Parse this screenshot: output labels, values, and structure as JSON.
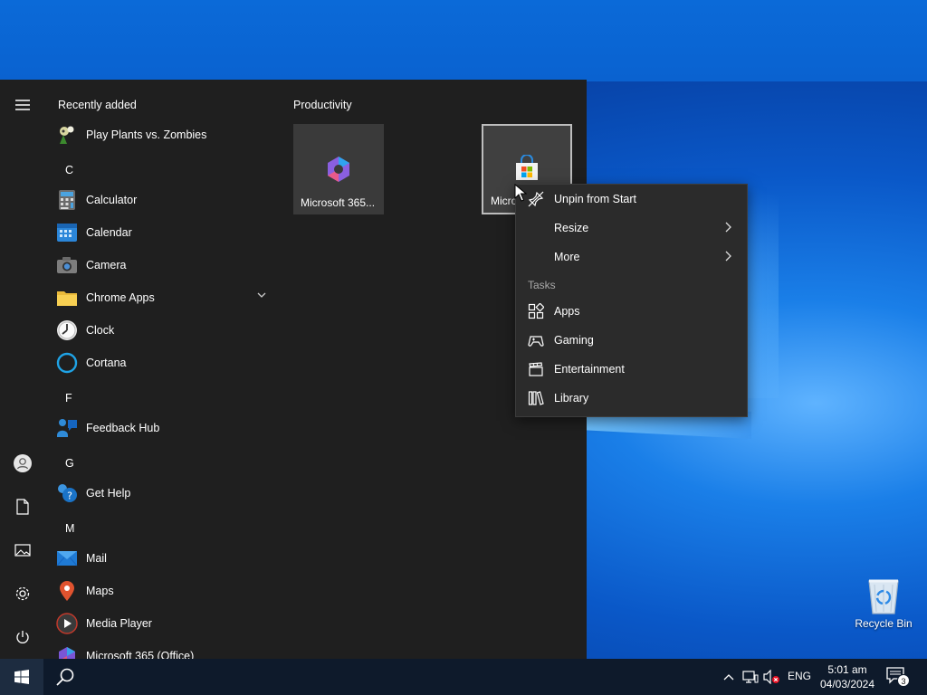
{
  "desktop": {
    "recycle_bin_label": "Recycle Bin"
  },
  "start_menu": {
    "recently_added_header": "Recently added",
    "apps": [
      {
        "name": "Play Plants vs. Zombies",
        "icon": "plants-vs-zombies-icon"
      },
      {
        "letter": "C"
      },
      {
        "name": "Calculator",
        "icon": "calculator-icon"
      },
      {
        "name": "Calendar",
        "icon": "calendar-icon"
      },
      {
        "name": "Camera",
        "icon": "camera-icon"
      },
      {
        "name": "Chrome Apps",
        "icon": "folder-icon",
        "expandable": true
      },
      {
        "name": "Clock",
        "icon": "clock-icon"
      },
      {
        "name": "Cortana",
        "icon": "cortana-icon"
      },
      {
        "letter": "F"
      },
      {
        "name": "Feedback Hub",
        "icon": "feedback-hub-icon"
      },
      {
        "letter": "G"
      },
      {
        "name": "Get Help",
        "icon": "get-help-icon"
      },
      {
        "letter": "M"
      },
      {
        "name": "Mail",
        "icon": "mail-icon"
      },
      {
        "name": "Maps",
        "icon": "maps-icon"
      },
      {
        "name": "Media Player",
        "icon": "media-player-icon"
      },
      {
        "name": "Microsoft 365 (Office)",
        "icon": "microsoft-365-icon"
      }
    ],
    "letters": {
      "c": "C",
      "f": "F",
      "g": "G",
      "m": "M"
    },
    "tiles_group_title": "Productivity",
    "tiles": [
      {
        "label": "Microsoft 365...",
        "icon": "microsoft-365-icon"
      },
      {
        "label": "Microsoft Store",
        "icon": "microsoft-store-icon"
      }
    ]
  },
  "context_menu": {
    "unpin": "Unpin from Start",
    "resize": "Resize",
    "more": "More",
    "tasks_header": "Tasks",
    "tasks": [
      "Apps",
      "Gaming",
      "Entertainment",
      "Library"
    ]
  },
  "taskbar": {
    "language": "ENG",
    "time": "5:01 am",
    "date": "04/03/2024",
    "notification_count": "3"
  },
  "colors": {
    "start_bg": "#1f1f1f",
    "context_bg": "#2b2b2b",
    "taskbar_bg": "#0e1a2b",
    "desktop_accent": "#0a58c8"
  }
}
